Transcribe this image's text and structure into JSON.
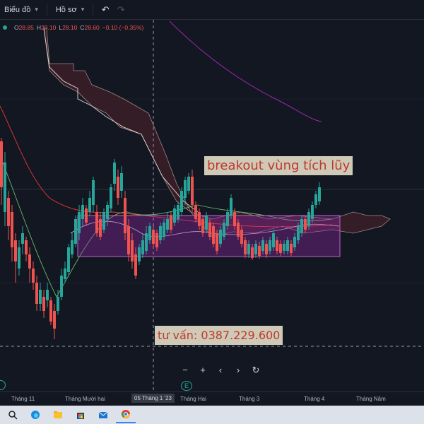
{
  "toolbar": {
    "chart_menu": "Biểu đồ",
    "profile_menu": "Hồ sơ",
    "undo_icon": "undo-icon",
    "redo_icon": "redo-icon"
  },
  "legend": {
    "open_label": "O",
    "open": "28.85",
    "high_label": "H",
    "high": "29.10",
    "low_label": "L",
    "low": "28.10",
    "close_label": "C",
    "close": "28.60",
    "change": "−0.10 (−0.35%)"
  },
  "annotations": {
    "breakout": "breakout vùng tích lũy",
    "contact": "tư vấn: 0387.229.600"
  },
  "controls": [
    "−",
    "+",
    "‹",
    "›",
    "↻"
  ],
  "time_axis": {
    "ticks": [
      "Tháng 11",
      "Tháng Mười hai",
      "05 Tháng 1 '23",
      "Tháng Hai",
      "Tháng 3",
      "Tháng 4",
      "Tháng Năm"
    ],
    "current": "05 Tháng 1 '23"
  },
  "colors": {
    "up": "#26a69a",
    "down": "#ef5350",
    "zone": "#9c27b0",
    "background": "#131722"
  },
  "taskbar": [
    "search-icon",
    "edge-browser-icon",
    "file-explorer-icon",
    "store-icon",
    "mail-icon",
    "chrome-icon"
  ]
}
